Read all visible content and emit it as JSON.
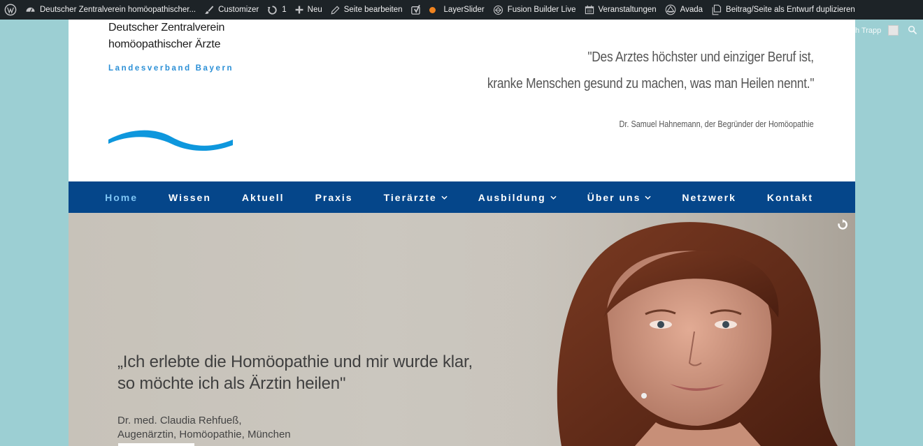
{
  "adminbar": {
    "site_title": "Deutscher Zentralverein homöopathischer...",
    "customizer": "Customizer",
    "updates_count": "1",
    "new_label": "Neu",
    "edit_page": "Seite bearbeiten",
    "layerslider": "LayerSlider",
    "fusion_builder": "Fusion Builder Live",
    "events": "Veranstaltungen",
    "avada": "Avada",
    "duplicate": "Beitrag/Seite als Entwurf duplizieren",
    "welcome": "Willkommen, Christoph Trapp"
  },
  "header": {
    "logo_line1": "Deutscher Zentralverein",
    "logo_line2": "homöopathischer Ärzte",
    "logo_sub": "Landesverband Bayern",
    "quote_line1": "\"Des Arztes höchster und einziger Beruf ist,",
    "quote_line2": "kranke Menschen gesund zu machen, was man Heilen nennt.\"",
    "quote_author": "Dr. Samuel Hahnemann, der Begründer der Homöopathie"
  },
  "nav": {
    "items": [
      {
        "label": "Home",
        "dropdown": false,
        "active": true
      },
      {
        "label": "Wissen",
        "dropdown": false
      },
      {
        "label": "Aktuell",
        "dropdown": false
      },
      {
        "label": "Praxis",
        "dropdown": false
      },
      {
        "label": "Tierärzte",
        "dropdown": true
      },
      {
        "label": "Ausbildung",
        "dropdown": true
      },
      {
        "label": "Über uns",
        "dropdown": true
      },
      {
        "label": "Netzwerk",
        "dropdown": false
      },
      {
        "label": "Kontakt",
        "dropdown": false
      }
    ],
    "chevron": "⌄"
  },
  "hero": {
    "quote_line1": "„Ich erlebte die Homöopathie und mir wurde klar,",
    "quote_line2": "so möchte ich als Ärztin heilen\"",
    "name_line1": "Dr. med. Claudia Rehfueß,",
    "name_line2": "Augenärztin, Homöopathie, München"
  },
  "colors": {
    "admin_bg": "#1d2327",
    "nav_bg": "#05468a",
    "nav_active": "#7fc6f5",
    "logo_blue": "#2a8fd6",
    "page_bg": "#9ccfd3"
  }
}
